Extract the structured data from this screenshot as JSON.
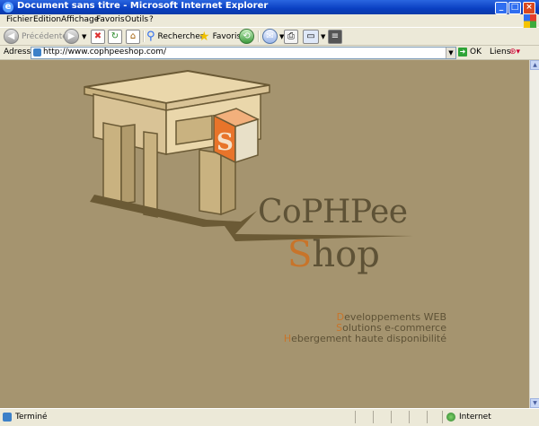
{
  "window": {
    "title": "Document sans titre - Microsoft Internet Explorer",
    "minimize": "_",
    "maximize": "□",
    "close": "×"
  },
  "menu": [
    "Fichier",
    "Edition",
    "Affichage",
    "Favoris",
    "Outils",
    "?"
  ],
  "toolbar": {
    "back_label": "Précédente",
    "search_label": "Rechercher",
    "favorites_label": "Favoris"
  },
  "address": {
    "label": "Adresse",
    "url": "http://www.cophpeeshop.com/",
    "go_label": "OK",
    "links_label": "Liens"
  },
  "page": {
    "brand_line1": "CoPHPee",
    "brand_shop_initial": "S",
    "brand_shop_rest": "hop",
    "logo_letter": "S",
    "services": [
      {
        "initial": "D",
        "rest": "eveloppements WEB"
      },
      {
        "initial": "S",
        "rest": "olutions e-commerce"
      },
      {
        "initial": "H",
        "rest": "ebergement haute disponibilité"
      }
    ]
  },
  "status": {
    "text": "Terminé",
    "zone": "Internet"
  },
  "colors": {
    "page_bg": "#a5946f",
    "brand_dark": "#5e5236",
    "brand_accent": "#c8742a",
    "logo_orange": "#e8742a"
  }
}
